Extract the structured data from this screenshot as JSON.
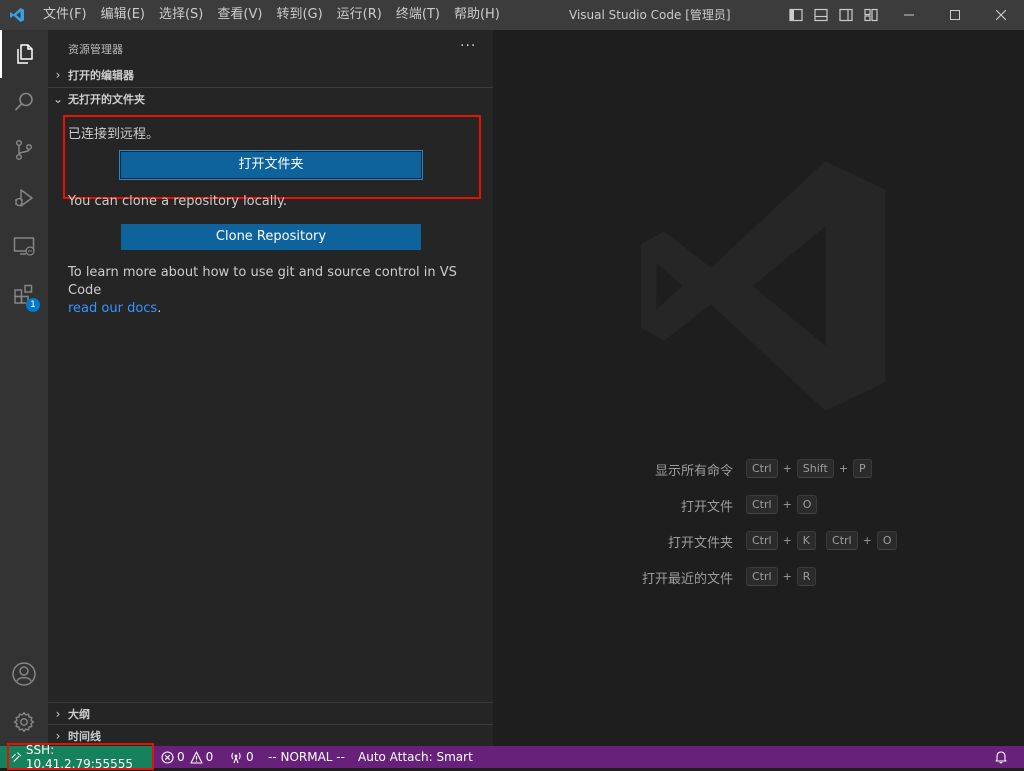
{
  "titlebar": {
    "menu": [
      "文件(F)",
      "编辑(E)",
      "选择(S)",
      "查看(V)",
      "转到(G)",
      "运行(R)",
      "终端(T)",
      "帮助(H)"
    ],
    "window_title": "Visual Studio Code [管理员]"
  },
  "activitybar": {
    "items": [
      "explorer-icon",
      "search-icon",
      "source-control-icon",
      "run-debug-icon",
      "remote-explorer-icon",
      "extensions-icon"
    ],
    "extensions_badge": "1",
    "bottom": [
      "account-icon",
      "settings-gear-icon"
    ]
  },
  "sidebar": {
    "title": "资源管理器",
    "more": "···",
    "open_editors": "打开的编辑器",
    "no_folder": "无打开的文件夹",
    "connected_text": "已连接到远程。",
    "open_folder_button": "打开文件夹",
    "clone_text": "You can clone a repository locally.",
    "clone_button": "Clone Repository",
    "learn_text": "To learn more about how to use git and source control in VS Code",
    "learn_link": "read our docs",
    "learn_period": ".",
    "outline": "大纲",
    "timeline": "时间线"
  },
  "editor": {
    "shortcuts": [
      {
        "label": "显示所有命令",
        "keys": [
          [
            "Ctrl",
            "Shift",
            "P"
          ]
        ]
      },
      {
        "label": "打开文件",
        "keys": [
          [
            "Ctrl",
            "O"
          ]
        ]
      },
      {
        "label": "打开文件夹",
        "keys": [
          [
            "Ctrl",
            "K"
          ],
          [
            "Ctrl",
            "O"
          ]
        ]
      },
      {
        "label": "打开最近的文件",
        "keys": [
          [
            "Ctrl",
            "R"
          ]
        ]
      }
    ]
  },
  "statusbar": {
    "remote": "SSH: 10.41.2.79:55555",
    "errors": "0",
    "warnings": "0",
    "ports": "0",
    "mode": "-- NORMAL --",
    "auto_attach": "Auto Attach: Smart"
  },
  "colors": {
    "statusbar": "#68217a",
    "remote": "#16825d",
    "button": "#0e639c",
    "highlight": "#e51400"
  }
}
